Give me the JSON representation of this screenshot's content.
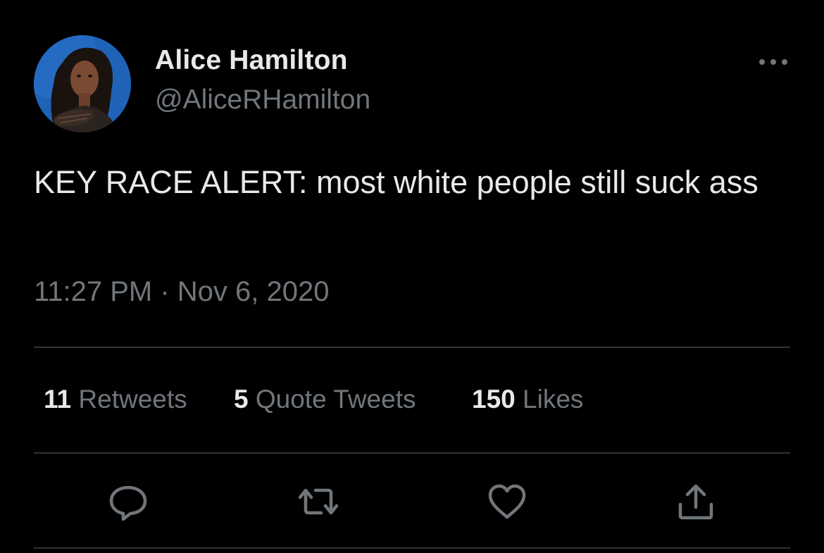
{
  "author": {
    "display_name": "Alice Hamilton",
    "handle": "@AliceRHamilton",
    "avatar_icon": "profile-photo"
  },
  "tweet": {
    "text": "KEY RACE ALERT: most white people still suck ass",
    "timestamp": "11:27 PM · Nov 6, 2020"
  },
  "stats": {
    "retweets": {
      "count": "11",
      "label": "Retweets"
    },
    "quote_tweets": {
      "count": "5",
      "label": "Quote Tweets"
    },
    "likes": {
      "count": "150",
      "label": "Likes"
    }
  },
  "actions": [
    {
      "icon": "reply-icon"
    },
    {
      "icon": "retweet-icon"
    },
    {
      "icon": "like-icon"
    },
    {
      "icon": "share-icon"
    }
  ],
  "menu_icon": "more-options-icon",
  "colors": {
    "background": "#000000",
    "primary_text": "#e7e9ea",
    "secondary_text": "#71767b",
    "divider": "#2f3336",
    "avatar_bg": "#1a5fb4"
  }
}
